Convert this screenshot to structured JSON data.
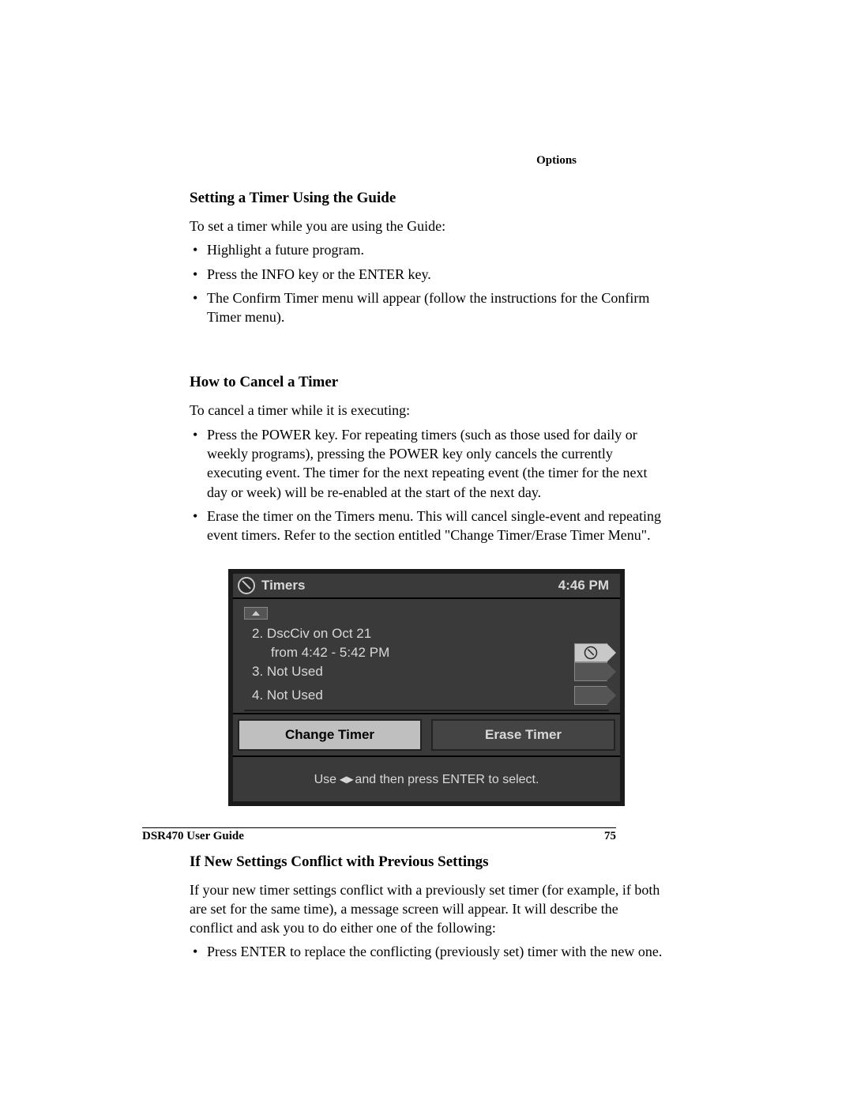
{
  "runningHead": "Options",
  "section1": {
    "heading": "Setting a Timer Using the Guide",
    "intro": "To set a timer while you are using the Guide:",
    "bullets": [
      "Highlight a future program.",
      "Press the INFO key or the ENTER key.",
      "The Confirm Timer menu will appear (follow the instructions for the Confirm Timer menu)."
    ]
  },
  "section2": {
    "heading": "How to Cancel a Timer",
    "intro": "To cancel a timer while it is executing:",
    "bullets": [
      "Press the POWER key. For repeating timers (such as those used for daily or weekly programs), pressing the POWER key only cancels the currently executing event. The timer for the next repeating event (the timer for the next day or week) will be re-enabled at the start of the next day.",
      "Erase the timer on the Timers menu. This will cancel single-event and repeating event timers. Refer to the section entitled \"Change Timer/Erase Timer Menu\"."
    ]
  },
  "timersUI": {
    "title": "Timers",
    "clock": "4:46 PM",
    "items": [
      {
        "index": "2.",
        "line1": "DscCiv on Oct 21",
        "line2": "from 4:42 - 5:42 PM",
        "iconActive": true
      },
      {
        "index": "3.",
        "line1": "Not Used",
        "line2": "",
        "iconActive": false
      },
      {
        "index": "4.",
        "line1": "Not Used",
        "line2": "",
        "iconActive": false
      }
    ],
    "buttons": {
      "change": "Change Timer",
      "erase": "Erase Timer"
    },
    "hintPrefix": "Use ",
    "hintSuffix": " and then press ENTER to select."
  },
  "section3": {
    "heading": "If New Settings Conflict with Previous Settings",
    "intro": "If your new timer settings conflict with a previously set timer (for example, if both are set for the same time), a message screen will appear. It will describe the conflict and ask you to do either one of the following:",
    "bullets": [
      "Press ENTER to replace the conflicting (previously set) timer with the new one."
    ]
  },
  "footer": {
    "docTitle": "DSR470 User Guide",
    "pageNum": "75"
  }
}
